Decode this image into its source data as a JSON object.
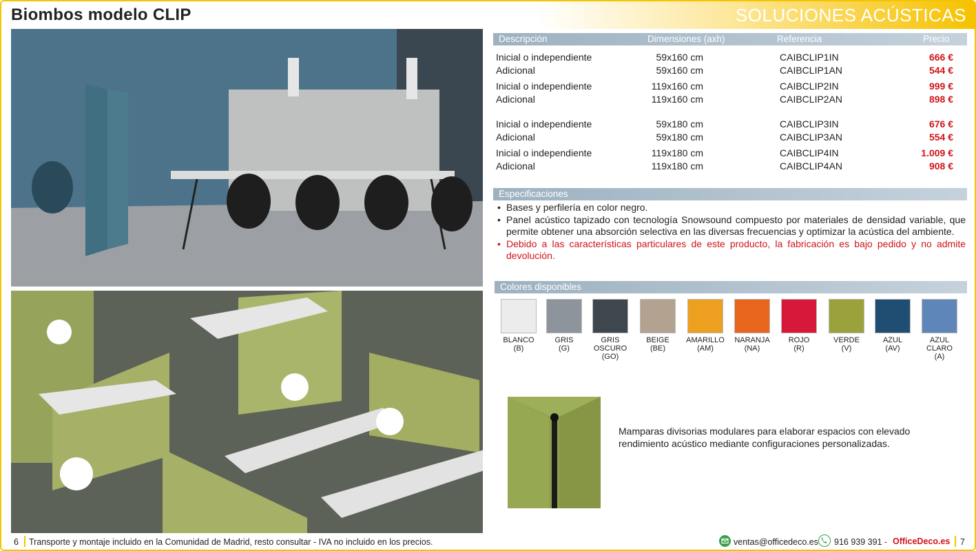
{
  "header": {
    "title": "Biombos modelo CLIP",
    "section": "SOLUCIONES ACÚSTICAS"
  },
  "price_table": {
    "headers": [
      "Descripción",
      "Dimensiones (axh)",
      "Referencia",
      "Precio"
    ],
    "rows": [
      {
        "desc": "Inicial o independiente",
        "dim": "59x160 cm",
        "ref": "CAIBCLIP1IN",
        "price": "666 €"
      },
      {
        "desc": "Adicional",
        "dim": "59x160 cm",
        "ref": "CAIBCLIP1AN",
        "price": "544 €"
      },
      {
        "desc": "Inicial o independiente",
        "dim": "119x160 cm",
        "ref": "CAIBCLIP2IN",
        "price": "999 €"
      },
      {
        "desc": "Adicional",
        "dim": "119x160 cm",
        "ref": "CAIBCLIP2AN",
        "price": "898 €"
      },
      {
        "desc": "Inicial o independiente",
        "dim": "59x180 cm",
        "ref": "CAIBCLIP3IN",
        "price": "676 €"
      },
      {
        "desc": "Adicional",
        "dim": "59x180 cm",
        "ref": "CAIBCLIP3AN",
        "price": "554 €"
      },
      {
        "desc": "Inicial o independiente",
        "dim": "119x180 cm",
        "ref": "CAIBCLIP4IN",
        "price": "1.009 €"
      },
      {
        "desc": "Adicional",
        "dim": "119x180 cm",
        "ref": "CAIBCLIP4AN",
        "price": "908 €"
      }
    ]
  },
  "specs": {
    "title": "Especificaciones",
    "items": [
      "Bases y perfilería en color negro.",
      "Panel acústico tapizado con tecnología Snowsound compuesto por materiales de densidad variable, que permite obtener una absorción selectiva en las diversas frecuencias y optimizar la acústica del ambiente.",
      "Debido a las características particulares de este producto, la fabricación es bajo pedido y no admite devolución."
    ],
    "bullet": "•",
    "warning_color": "#d0131b"
  },
  "colors": {
    "title": "Colores disponibles",
    "items": [
      {
        "name": "BLANCO",
        "code": "(B)",
        "hex": "#ececec"
      },
      {
        "name": "GRIS",
        "code": "(G)",
        "hex": "#8e949b"
      },
      {
        "name": "GRIS OSCURO",
        "code": "(GO)",
        "hex": "#3e474d"
      },
      {
        "name": "BEIGE",
        "code": "(BE)",
        "hex": "#b3a28f"
      },
      {
        "name": "AMARILLO",
        "code": "(AM)",
        "hex": "#eda01f"
      },
      {
        "name": "NARANJA",
        "code": "(NA)",
        "hex": "#e8651e"
      },
      {
        "name": "ROJO",
        "code": "(R)",
        "hex": "#d8183a"
      },
      {
        "name": "VERDE",
        "code": "(V)",
        "hex": "#9aa23c"
      },
      {
        "name": "AZUL",
        "code": "(AV)",
        "hex": "#1f4e72"
      },
      {
        "name": "AZUL CLARO",
        "code": "(A)",
        "hex": "#5e86b8"
      }
    ]
  },
  "description": "Mamparas divisorias modulares para elaborar espacios con elevado rendimiento acústico mediante configuraciones personalizadas.",
  "footer": {
    "page_left": "6",
    "note": "Transporte y montaje incluido en la Comunidad de Madrid, resto consultar - IVA no incluido en los precios.",
    "email": "ventas@officedeco.es",
    "phone": "916 939 391",
    "dash": "-",
    "brand": "OfficeDeco.es",
    "page_right": "7"
  },
  "theme": {
    "accent": "#f5c400",
    "price_color": "#d0131b",
    "band_color": "#9db1c0"
  }
}
